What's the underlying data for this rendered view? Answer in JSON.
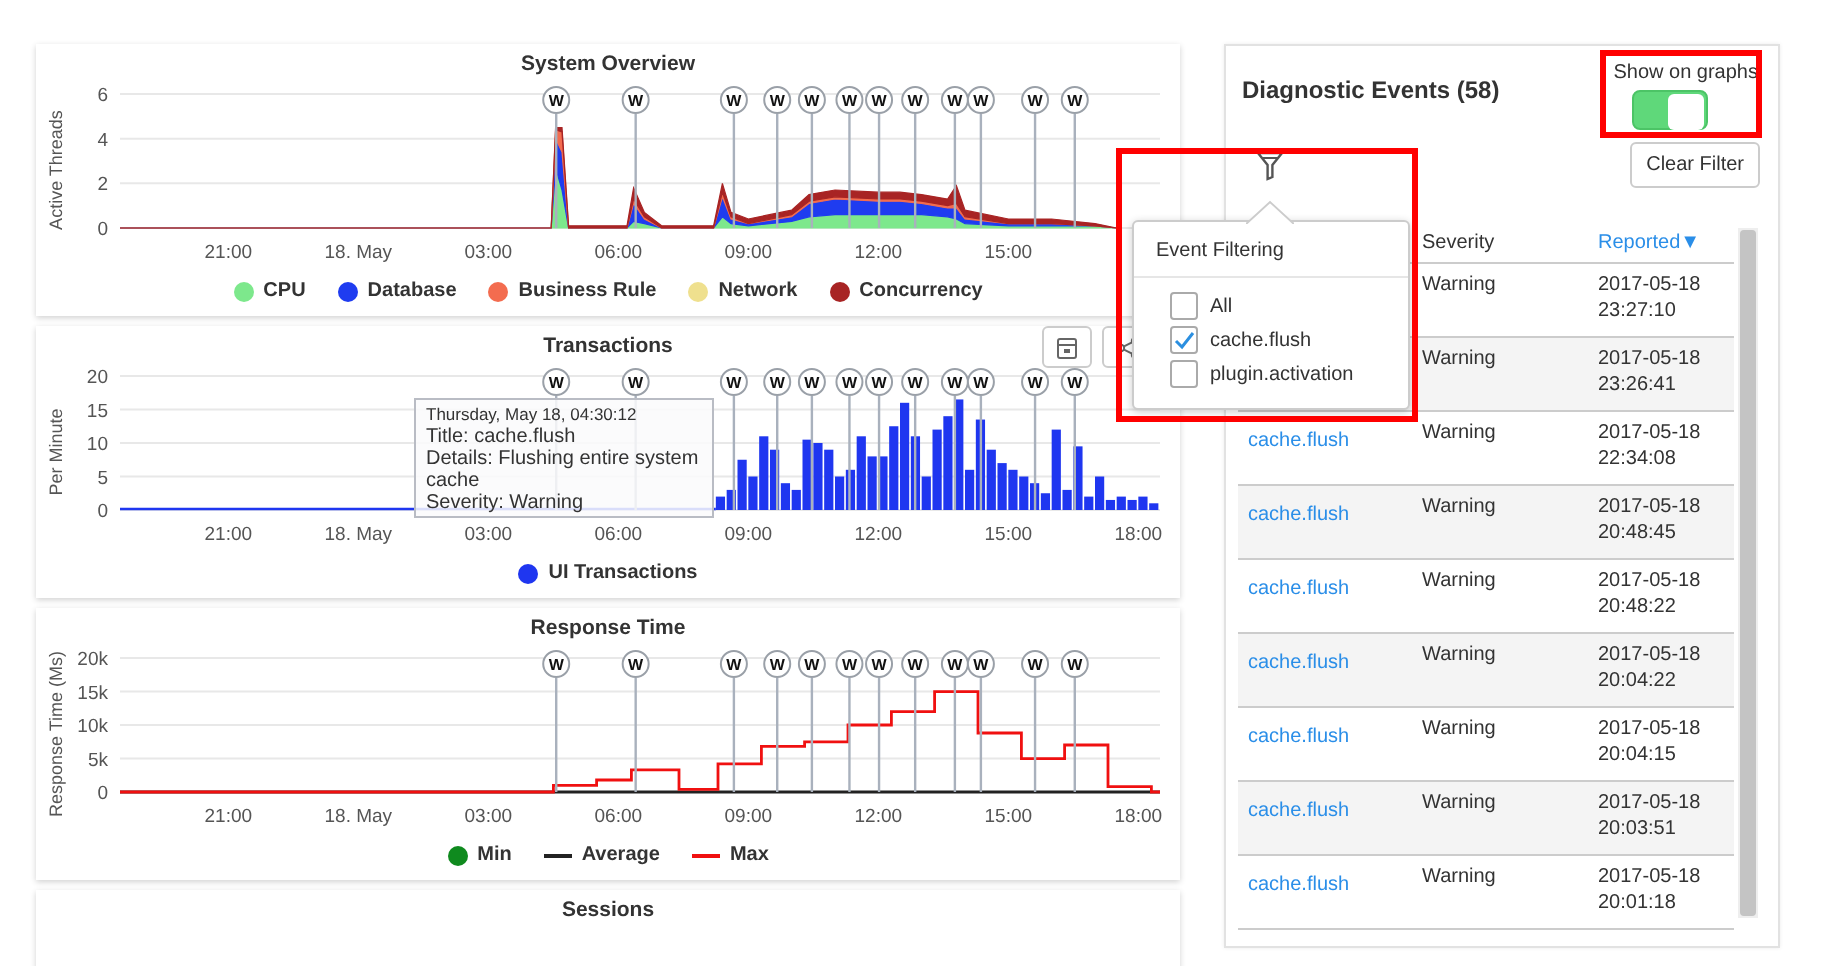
{
  "charts": [
    {
      "title": "System Overview",
      "chart_data": {
        "type": "area",
        "ylabel": "Active Threads",
        "stacked": true,
        "grid": true,
        "xlim": [
          "2017-05-17 18:30",
          "2017-05-18 18:30"
        ],
        "ylim": [
          0,
          6
        ],
        "yticks": [
          0,
          2,
          4,
          6
        ],
        "xticks": [
          {
            "value": "2017-05-17 21:00",
            "label": "21:00"
          },
          {
            "value": "2017-05-18 00:00",
            "label": "18. May"
          },
          {
            "value": "2017-05-18 03:00",
            "label": "03:00"
          },
          {
            "value": "2017-05-18 06:00",
            "label": "06:00"
          },
          {
            "value": "2017-05-18 09:00",
            "label": "09:00"
          },
          {
            "value": "2017-05-18 12:00",
            "label": "12:00"
          },
          {
            "value": "2017-05-18 15:00",
            "label": "15:00"
          }
        ],
        "x": [
          "2017-05-17 18:30",
          "2017-05-18 04:27",
          "2017-05-18 04:33",
          "2017-05-18 04:42",
          "2017-05-18 04:51",
          "2017-05-18 05:00",
          "2017-05-18 06:12",
          "2017-05-18 06:21",
          "2017-05-18 06:36",
          "2017-05-18 07:00",
          "2017-05-18 08:12",
          "2017-05-18 08:24",
          "2017-05-18 08:36",
          "2017-05-18 09:00",
          "2017-05-18 10:00",
          "2017-05-18 10:24",
          "2017-05-18 11:00",
          "2017-05-18 12:00",
          "2017-05-18 12:30",
          "2017-05-18 13:00",
          "2017-05-18 13:36",
          "2017-05-18 13:48",
          "2017-05-18 14:00",
          "2017-05-18 15:00",
          "2017-05-18 16:00",
          "2017-05-18 17:00",
          "2017-05-18 17:30"
        ],
        "series": [
          {
            "name": "CPU",
            "color": "#7de88c",
            "values": [
              0,
              0,
              2.7,
              1.7,
              0,
              0,
              0,
              0.3,
              0.2,
              0,
              0,
              0.5,
              0.2,
              0.1,
              0.3,
              0.5,
              0.6,
              0.6,
              0.6,
              0.6,
              0.5,
              0.4,
              0.2,
              0.1,
              0.1,
              0.1,
              0
            ]
          },
          {
            "name": "Database",
            "color": "#1f3cf0",
            "values": [
              0,
              0,
              1.3,
              1.7,
              0,
              0,
              0,
              0.8,
              0.2,
              0,
              0,
              0.9,
              0.2,
              0.1,
              0.2,
              0.6,
              0.7,
              0.6,
              0.6,
              0.5,
              0.4,
              0.5,
              0.2,
              0.1,
              0.1,
              0,
              0
            ]
          },
          {
            "name": "Business Rule",
            "color": "#f36c4f",
            "values": [
              0,
              0,
              0.4,
              0.9,
              0,
              0,
              0,
              0.2,
              0.1,
              0,
              0,
              0.2,
              0.1,
              0,
              0.1,
              0.1,
              0.1,
              0.1,
              0.1,
              0.1,
              0.1,
              0.2,
              0.1,
              0,
              0,
              0,
              0
            ]
          },
          {
            "name": "Network",
            "color": "#efe08e",
            "values": [
              null,
              null,
              null,
              null,
              null,
              null,
              null,
              null,
              null,
              null,
              null,
              null,
              null,
              null,
              null,
              null,
              null,
              null,
              null,
              null,
              null,
              null,
              null,
              null,
              null,
              null,
              null
            ]
          },
          {
            "name": "Concurrency",
            "color": "#a82424",
            "values": [
              0,
              0,
              0.1,
              0.2,
              0.1,
              0.1,
              0.1,
              0.5,
              0.2,
              0.1,
              0.1,
              0.4,
              0.2,
              0.2,
              0.2,
              0.3,
              0.3,
              0.3,
              0.3,
              0.3,
              0.3,
              0.8,
              0.3,
              0.2,
              0.2,
              0.1,
              0
            ]
          }
        ],
        "annotations": [
          {
            "x": "2017-05-18 04:34",
            "text": "W"
          },
          {
            "x": "2017-05-18 06:24",
            "text": "W"
          },
          {
            "x": "2017-05-18 08:40",
            "text": "W"
          },
          {
            "x": "2017-05-18 09:40",
            "text": "W"
          },
          {
            "x": "2017-05-18 10:28",
            "text": "W"
          },
          {
            "x": "2017-05-18 11:20",
            "text": "W"
          },
          {
            "x": "2017-05-18 12:01",
            "text": "W"
          },
          {
            "x": "2017-05-18 12:51",
            "text": "W"
          },
          {
            "x": "2017-05-18 13:46",
            "text": "W"
          },
          {
            "x": "2017-05-18 14:22",
            "text": "W"
          },
          {
            "x": "2017-05-18 15:37",
            "text": "W"
          },
          {
            "x": "2017-05-18 16:32",
            "text": "W"
          }
        ]
      }
    },
    {
      "title": "Transactions",
      "toolbar_shown": true,
      "chart_data": {
        "type": "bar",
        "ylabel": "Per Minute",
        "grid": true,
        "xlim": [
          "2017-05-17 18:30",
          "2017-05-18 18:30"
        ],
        "ylim": [
          0,
          20
        ],
        "yticks": [
          0,
          5,
          10,
          15,
          20
        ],
        "xticks": [
          {
            "value": "2017-05-17 21:00",
            "label": "21:00"
          },
          {
            "value": "2017-05-18 00:00",
            "label": "18. May"
          },
          {
            "value": "2017-05-18 03:00",
            "label": "03:00"
          },
          {
            "value": "2017-05-18 06:00",
            "label": "06:00"
          },
          {
            "value": "2017-05-18 09:00",
            "label": "09:00"
          },
          {
            "value": "2017-05-18 12:00",
            "label": "12:00"
          },
          {
            "value": "2017-05-18 15:00",
            "label": "15:00"
          },
          {
            "value": "2017-05-18 18:00",
            "label": "18:00"
          }
        ],
        "x": [
          "2017-05-18 08:15",
          "2017-05-18 08:30",
          "2017-05-18 08:45",
          "2017-05-18 09:00",
          "2017-05-18 09:15",
          "2017-05-18 09:30",
          "2017-05-18 09:45",
          "2017-05-18 10:00",
          "2017-05-18 10:15",
          "2017-05-18 10:30",
          "2017-05-18 10:45",
          "2017-05-18 11:00",
          "2017-05-18 11:15",
          "2017-05-18 11:30",
          "2017-05-18 11:45",
          "2017-05-18 12:00",
          "2017-05-18 12:15",
          "2017-05-18 12:30",
          "2017-05-18 12:45",
          "2017-05-18 13:00",
          "2017-05-18 13:15",
          "2017-05-18 13:30",
          "2017-05-18 13:45",
          "2017-05-18 14:00",
          "2017-05-18 14:15",
          "2017-05-18 14:30",
          "2017-05-18 14:45",
          "2017-05-18 15:00",
          "2017-05-18 15:15",
          "2017-05-18 15:30",
          "2017-05-18 15:45",
          "2017-05-18 16:00",
          "2017-05-18 16:15",
          "2017-05-18 16:30",
          "2017-05-18 16:45",
          "2017-05-18 17:00",
          "2017-05-18 17:15",
          "2017-05-18 17:30",
          "2017-05-18 17:45",
          "2017-05-18 18:00",
          "2017-05-18 18:15"
        ],
        "series": [
          {
            "name": "UI Transactions",
            "color": "#1f36f0",
            "values": [
              2,
              3,
              7.5,
              5,
              11,
              9,
              4,
              3,
              10.5,
              10,
              9,
              5,
              6,
              11,
              8,
              8,
              12.5,
              16,
              11,
              5,
              12,
              14,
              16.5,
              6,
              13.5,
              9,
              7,
              6,
              5,
              4,
              2.5,
              12,
              3,
              9.5,
              2,
              5,
              1.5,
              2,
              1.5,
              2,
              1
            ]
          }
        ],
        "annotations": [
          {
            "x": "2017-05-18 04:34",
            "text": "W"
          },
          {
            "x": "2017-05-18 06:24",
            "text": "W"
          },
          {
            "x": "2017-05-18 08:40",
            "text": "W"
          },
          {
            "x": "2017-05-18 09:40",
            "text": "W"
          },
          {
            "x": "2017-05-18 10:28",
            "text": "W"
          },
          {
            "x": "2017-05-18 11:20",
            "text": "W"
          },
          {
            "x": "2017-05-18 12:01",
            "text": "W"
          },
          {
            "x": "2017-05-18 12:51",
            "text": "W"
          },
          {
            "x": "2017-05-18 13:46",
            "text": "W"
          },
          {
            "x": "2017-05-18 14:22",
            "text": "W"
          },
          {
            "x": "2017-05-18 15:37",
            "text": "W"
          },
          {
            "x": "2017-05-18 16:32",
            "text": "W"
          }
        ]
      },
      "tooltip": {
        "date": "Thursday, May 18, 04:30:12",
        "lines": [
          "Title: cache.flush",
          "Details: Flushing entire system cache",
          "Severity: Warning"
        ]
      }
    },
    {
      "title": "Response Time",
      "chart_data": {
        "type": "step",
        "ylabel": "Response Time (Ms)",
        "grid": true,
        "xlim": [
          "2017-05-17 18:30",
          "2017-05-18 18:30"
        ],
        "ylim": [
          0,
          20000
        ],
        "yticks": [
          0,
          {
            "value": 5000,
            "label": "5k"
          },
          {
            "value": 10000,
            "label": "10k"
          },
          {
            "value": 15000,
            "label": "15k"
          },
          {
            "value": 20000,
            "label": "20k"
          }
        ],
        "xticks": [
          {
            "value": "2017-05-17 21:00",
            "label": "21:00"
          },
          {
            "value": "2017-05-18 00:00",
            "label": "18. May"
          },
          {
            "value": "2017-05-18 03:00",
            "label": "03:00"
          },
          {
            "value": "2017-05-18 06:00",
            "label": "06:00"
          },
          {
            "value": "2017-05-18 09:00",
            "label": "09:00"
          },
          {
            "value": "2017-05-18 12:00",
            "label": "12:00"
          },
          {
            "value": "2017-05-18 15:00",
            "label": "15:00"
          },
          {
            "value": "2017-05-18 18:00",
            "label": "18:00"
          }
        ],
        "x": [
          "2017-05-17 18:30",
          "2017-05-18 04:30",
          "2017-05-18 05:30",
          "2017-05-18 06:18",
          "2017-05-18 07:24",
          "2017-05-18 08:18",
          "2017-05-18 09:18",
          "2017-05-18 10:18",
          "2017-05-18 11:18",
          "2017-05-18 12:18",
          "2017-05-18 13:18",
          "2017-05-18 14:18",
          "2017-05-18 15:18",
          "2017-05-18 16:18",
          "2017-05-18 17:18",
          "2017-05-18 18:18",
          "2017-05-18 18:30"
        ],
        "series": [
          {
            "name": "Min",
            "color": "#0f8a1e",
            "type": "scatter",
            "values": [
              null,
              null,
              null,
              null,
              null,
              null,
              null,
              null,
              null,
              null,
              null,
              null,
              null,
              null,
              null,
              null,
              null
            ]
          },
          {
            "name": "Average",
            "color": "#222222",
            "type": "step",
            "values": [
              0,
              0,
              0,
              0,
              0,
              0,
              0,
              0,
              0,
              0,
              0,
              0,
              0,
              0,
              0,
              0,
              0
            ]
          },
          {
            "name": "Max",
            "color": "#f01010",
            "type": "step",
            "values": [
              0,
              1000,
              1800,
              3300,
              400,
              4200,
              6800,
              7500,
              10000,
              12000,
              15000,
              8800,
              5000,
              7000,
              800,
              0,
              0
            ]
          }
        ],
        "annotations": [
          {
            "x": "2017-05-18 04:34",
            "text": "W"
          },
          {
            "x": "2017-05-18 06:24",
            "text": "W"
          },
          {
            "x": "2017-05-18 08:40",
            "text": "W"
          },
          {
            "x": "2017-05-18 09:40",
            "text": "W"
          },
          {
            "x": "2017-05-18 10:28",
            "text": "W"
          },
          {
            "x": "2017-05-18 11:20",
            "text": "W"
          },
          {
            "x": "2017-05-18 12:01",
            "text": "W"
          },
          {
            "x": "2017-05-18 12:51",
            "text": "W"
          },
          {
            "x": "2017-05-18 13:46",
            "text": "W"
          },
          {
            "x": "2017-05-18 14:22",
            "text": "W"
          },
          {
            "x": "2017-05-18 15:37",
            "text": "W"
          },
          {
            "x": "2017-05-18 16:32",
            "text": "W"
          }
        ]
      }
    },
    {
      "title": "Sessions"
    }
  ],
  "events_panel": {
    "title": "Diagnostic Events (58)",
    "show_on_graphs": {
      "label": "Show on graphs",
      "on": true
    },
    "clear_filter": "Clear Filter",
    "columns": [
      {
        "label": "Severity",
        "sorted": false
      },
      {
        "label": "Reported",
        "sorted": true,
        "sort_indicator": "▼"
      }
    ],
    "rows": [
      {
        "severity": "Warning",
        "reported": "2017-05-18 23:27:10"
      },
      {
        "severity": "Warning",
        "reported": "2017-05-18 23:26:41"
      },
      {
        "event": "cache.flush",
        "severity": "Warning",
        "reported": "2017-05-18 22:34:08"
      },
      {
        "event": "cache.flush",
        "severity": "Warning",
        "reported": "2017-05-18 20:48:45"
      },
      {
        "event": "cache.flush",
        "severity": "Warning",
        "reported": "2017-05-18 20:48:22"
      },
      {
        "event": "cache.flush",
        "severity": "Warning",
        "reported": "2017-05-18 20:04:22"
      },
      {
        "event": "cache.flush",
        "severity": "Warning",
        "reported": "2017-05-18 20:04:15"
      },
      {
        "event": "cache.flush",
        "severity": "Warning",
        "reported": "2017-05-18 20:03:51"
      },
      {
        "event": "cache.flush",
        "severity": "Warning",
        "reported": "2017-05-18 20:01:18"
      }
    ]
  },
  "filter_popup": {
    "title": "Event Filtering",
    "options": [
      {
        "label": "All",
        "checked": false
      },
      {
        "label": "cache.flush",
        "checked": true
      },
      {
        "label": "plugin.activation",
        "checked": false
      }
    ]
  }
}
